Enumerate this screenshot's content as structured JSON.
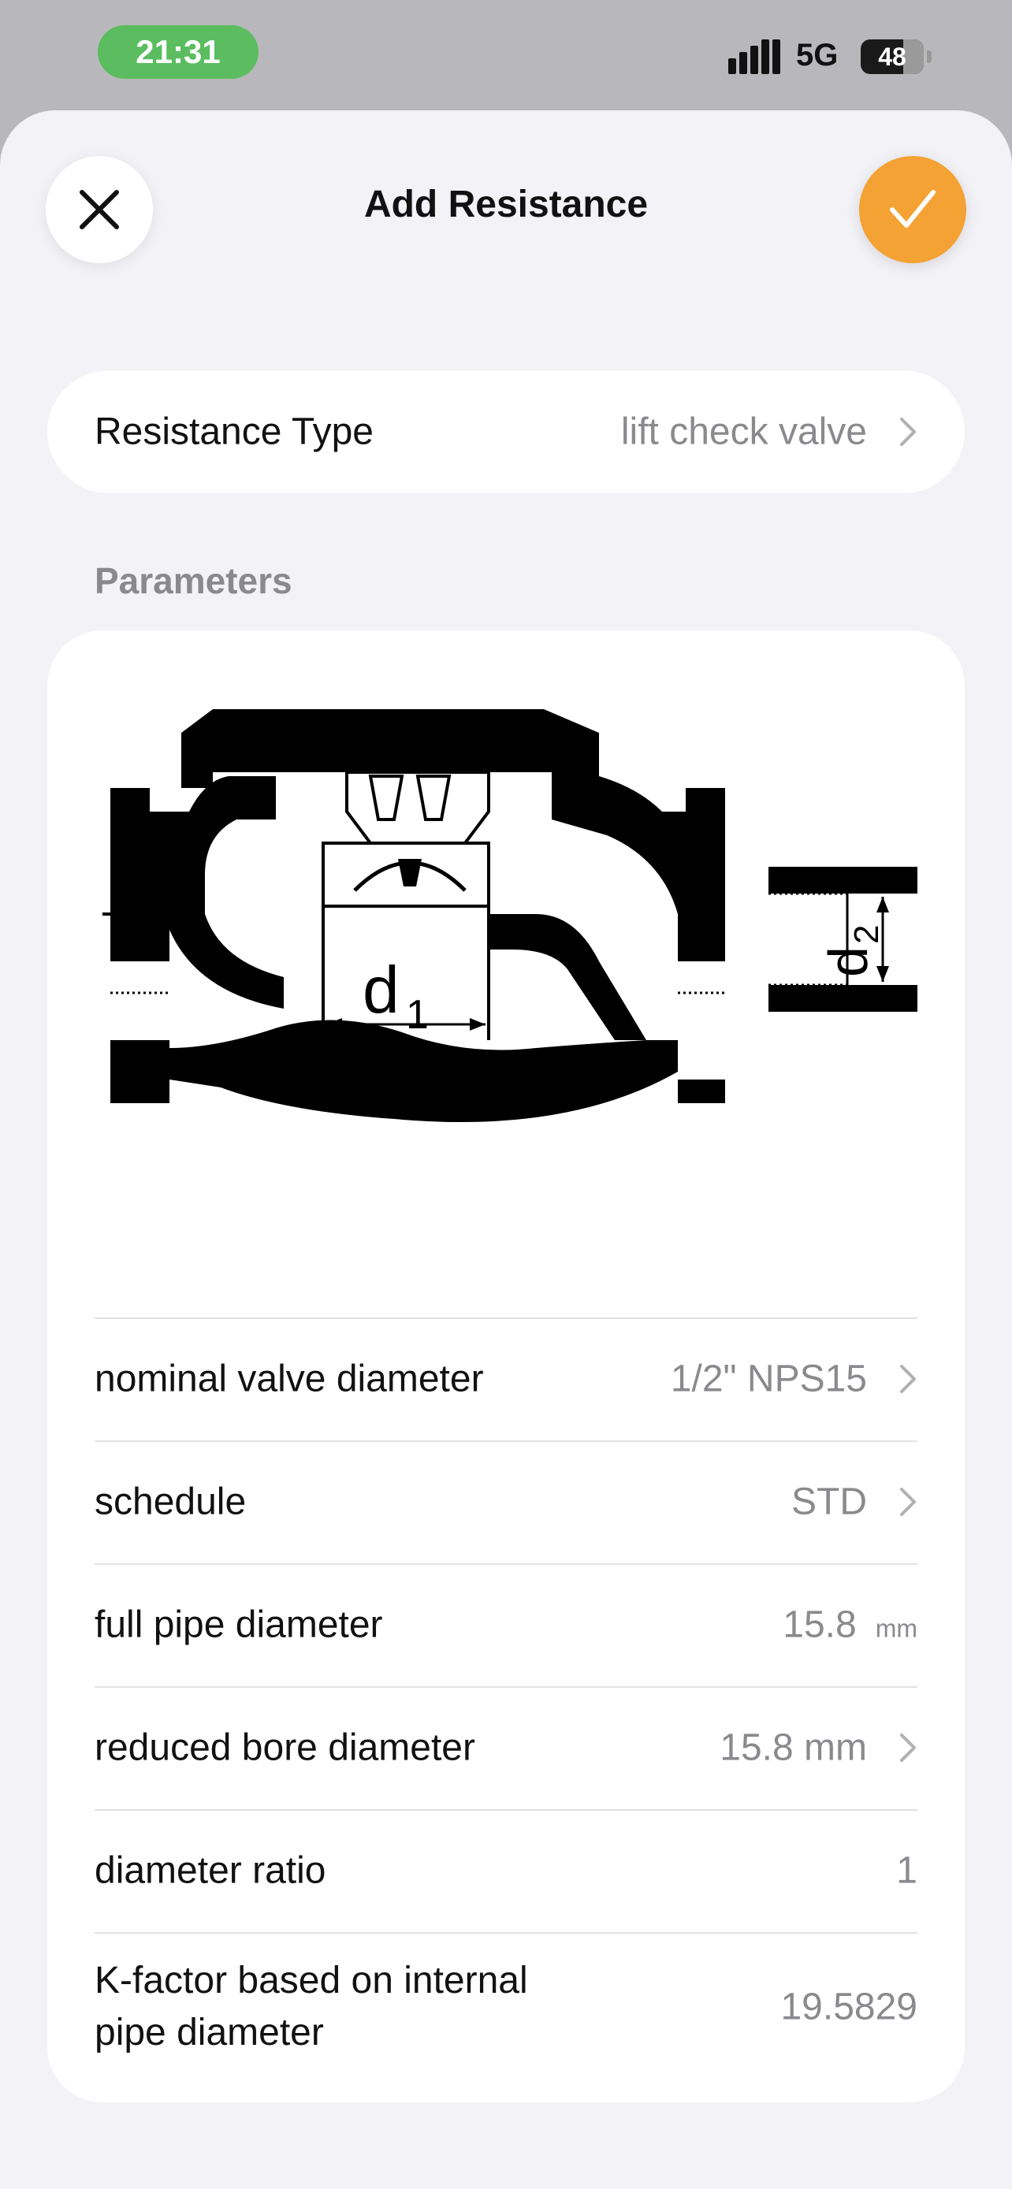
{
  "status": {
    "time": "21:31",
    "network": "5G",
    "battery": "48"
  },
  "header": {
    "title": "Add Resistance"
  },
  "resistance_type": {
    "label": "Resistance Type",
    "value": "lift check valve"
  },
  "parameters": {
    "section_title": "Parameters",
    "diagram_labels": {
      "d1": "d",
      "d1_sub": "1",
      "d2": "d",
      "d2_sub": "2"
    },
    "rows": [
      {
        "label": "nominal valve diameter",
        "value": "1/2\" NPS15"
      },
      {
        "label": "schedule",
        "value": "STD"
      },
      {
        "label": "full pipe diameter",
        "value": "15.8",
        "unit": "mm"
      },
      {
        "label": "reduced bore diameter",
        "value": "15.8 mm"
      },
      {
        "label": "diameter ratio",
        "value": "1"
      },
      {
        "label": "K-factor based on internal",
        "label2": "pipe diameter",
        "value": "19.5829"
      }
    ]
  },
  "colors": {
    "accent": "#f5a234",
    "status_green": "#5bbd5f"
  }
}
